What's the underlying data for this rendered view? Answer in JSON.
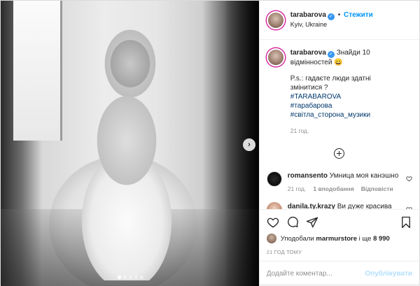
{
  "header": {
    "username": "tarabarova",
    "separator": "•",
    "follow_label": "Стежити",
    "location": "Kyiv, Ukraine"
  },
  "caption": {
    "username": "tarabarova",
    "text_line1": "Знайди 10",
    "text_line2": "відмінностей",
    "emoji": "😄",
    "ps": "P.s.: гадаєте люди здатні змінитися ?",
    "hashtags": [
      "#TARABAROVA",
      "#тарабарова",
      "#світла_сторона_музики"
    ],
    "time": "21 год."
  },
  "comments": [
    {
      "username": "romansento",
      "text": "Умница моя канэшно",
      "time": "21 год.",
      "likes": "1 вподобання",
      "reply": "Відповісти"
    },
    {
      "username": "danila.ty.krazy",
      "text": "Ви дуже красива"
    }
  ],
  "likes": {
    "prefix": "Уподобали",
    "user": "marmurstore",
    "connector": "і ще",
    "count": "8 990"
  },
  "post_time": "21 ГОД ТОМУ",
  "comment_input": {
    "placeholder": "Додайте коментар..."
  },
  "publish_label": "Опублікувати",
  "carousel": {
    "dots": 5,
    "active_dot": 0,
    "next_icon": "chevron-right-icon"
  },
  "colors": {
    "accent": "#0095f6",
    "verified": "#3897f0",
    "publish_disabled": "#b2dffc",
    "hashtag": "#00376b"
  }
}
